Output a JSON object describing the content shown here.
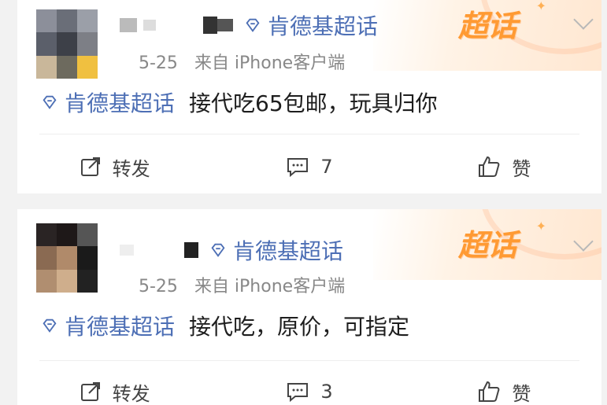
{
  "posts": [
    {
      "supertopic": "肯德基超话",
      "date": "5-25",
      "source": "来自 iPhone客户端",
      "topic_link": "肯德基超话",
      "text": "接代吃65包邮，玩具归你",
      "repost_label": "转发",
      "comment_count": "7",
      "like_label": "赞",
      "brand": "超话"
    },
    {
      "supertopic": "肯德基超话",
      "date": "5-25",
      "source": "来自 iPhone客户端",
      "topic_link": "肯德基超话",
      "text": "接代吃，原价，可指定",
      "repost_label": "转发",
      "comment_count": "3",
      "like_label": "赞",
      "brand": "超话"
    }
  ],
  "colors": {
    "link": "#4d6fb5",
    "brand": "#ff9a33",
    "meta": "#888888",
    "text": "#1e1e1e"
  }
}
